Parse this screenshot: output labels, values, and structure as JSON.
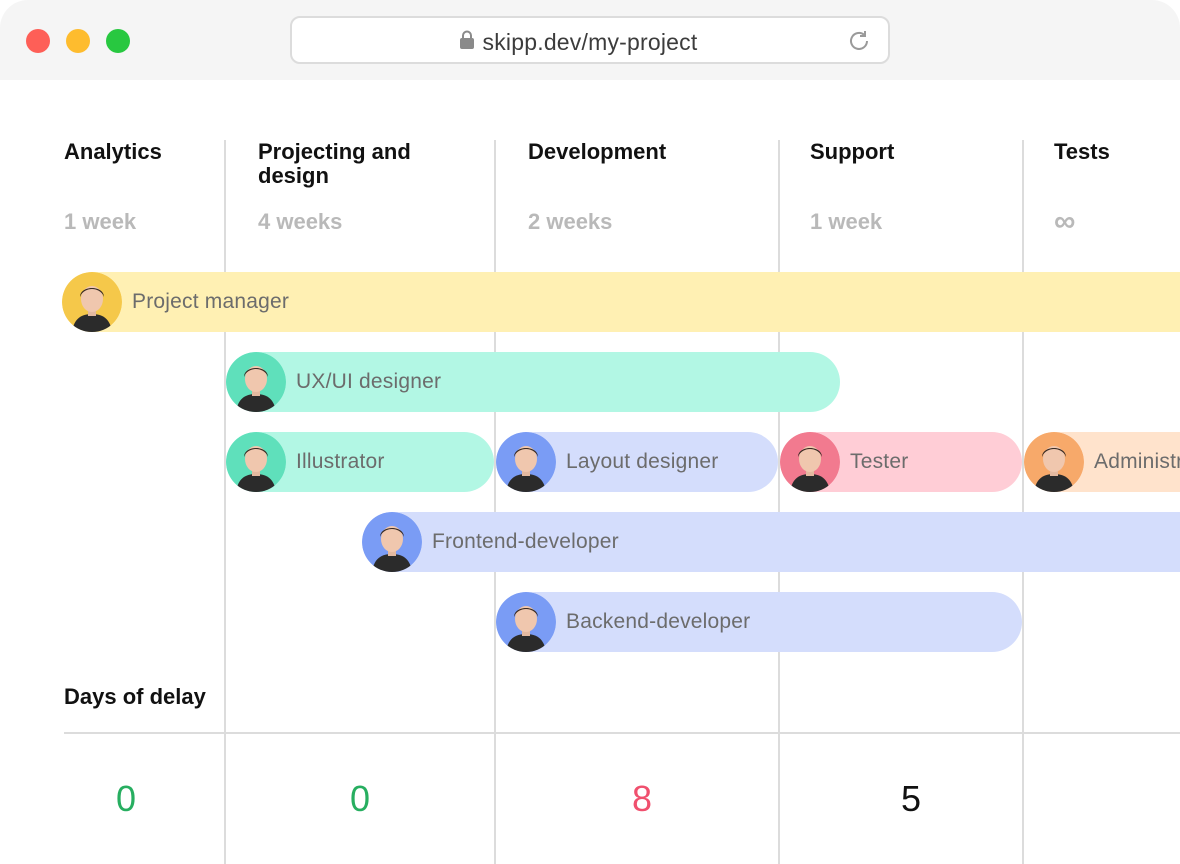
{
  "browser": {
    "url": "skipp.dev/my-project"
  },
  "phases": [
    {
      "title": "Analytics",
      "duration": "1 week"
    },
    {
      "title": "Projecting and design",
      "duration": "4 weeks"
    },
    {
      "title": "Development",
      "duration": "2 weeks"
    },
    {
      "title": "Support",
      "duration": "1 week"
    },
    {
      "title": "Tests",
      "duration": "∞"
    }
  ],
  "roles": [
    {
      "label": "Project manager",
      "color": "#fff0b3",
      "avatar_bg": "#f5c84a"
    },
    {
      "label": "UX/UI designer",
      "color": "#b2f7e4",
      "avatar_bg": "#5fe0bb"
    },
    {
      "label": "Illustrator",
      "color": "#b2f7e4",
      "avatar_bg": "#5fe0bb"
    },
    {
      "label": "Layout designer",
      "color": "#d4ddfc",
      "avatar_bg": "#7a9cf5"
    },
    {
      "label": "Tester",
      "color": "#ffcdd6",
      "avatar_bg": "#f27a8f"
    },
    {
      "label": "Administrator",
      "color": "#ffe3cc",
      "avatar_bg": "#f7a96a"
    },
    {
      "label": "Frontend-developer",
      "color": "#d4ddfc",
      "avatar_bg": "#7a9cf5"
    },
    {
      "label": "Backend-developer",
      "color": "#d4ddfc",
      "avatar_bg": "#7a9cf5"
    }
  ],
  "delays": {
    "title": "Days of delay",
    "values": [
      {
        "value": "0",
        "color": "#27ae60"
      },
      {
        "value": "0",
        "color": "#27ae60"
      },
      {
        "value": "8",
        "color": "#f0506e"
      },
      {
        "value": "5",
        "color": "#111111"
      }
    ]
  }
}
